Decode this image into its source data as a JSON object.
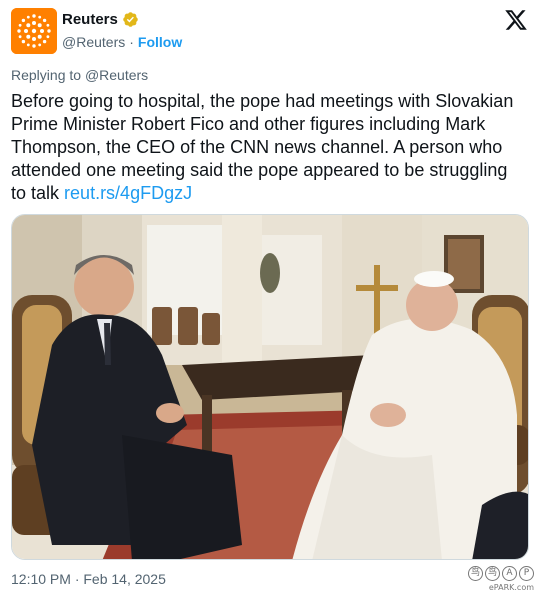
{
  "author": {
    "display_name": "Reuters",
    "handle": "@Reuters",
    "follow_label": "Follow",
    "verified_icon": "verified-badge-gold",
    "brand_color": "#ff8000"
  },
  "reply": {
    "prefix": "Replying to",
    "mention": "@Reuters"
  },
  "tweet": {
    "text": "Before going to hospital, the pope had meetings with Slovakian Prime Minister Robert Fico and other figures including Mark Thompson, the CEO of the CNN news channel. A person who attended one meeting said the pope appeared to be struggling to talk",
    "link": "reut.rs/4gFDgzJ",
    "link_color": "#1d9bf0"
  },
  "media": {
    "type": "photo",
    "content": "pope-meeting-robert-fico-photo"
  },
  "timestamp": "12:10 PM · Feb 14, 2025",
  "watermark": {
    "chars": [
      "鸟",
      "鸟",
      "A",
      "P"
    ],
    "site": "ePARK.com"
  },
  "icons": {
    "platform": "x-logo",
    "separator": "·"
  }
}
